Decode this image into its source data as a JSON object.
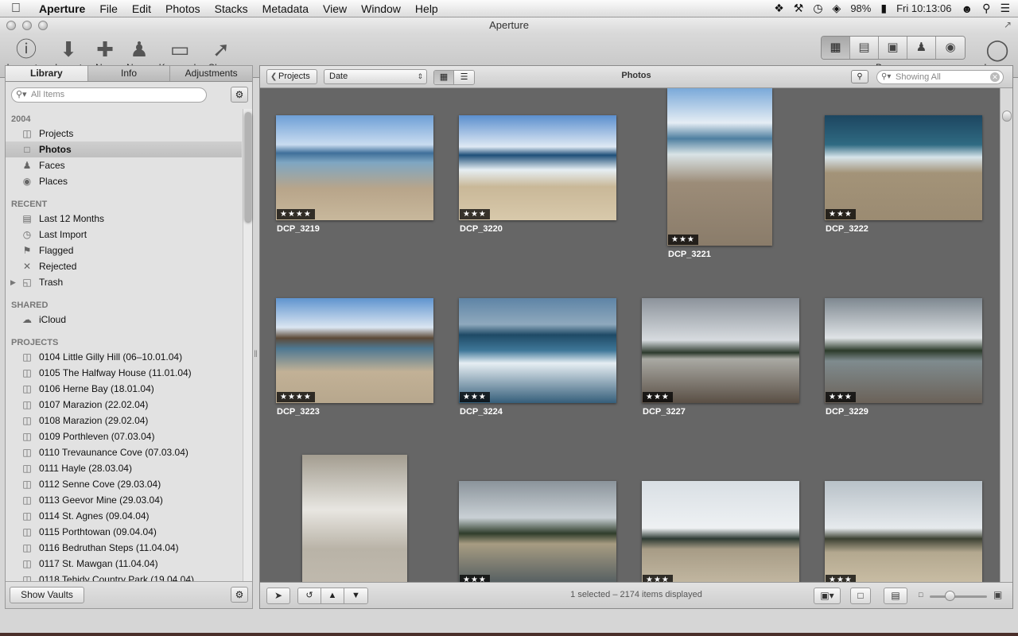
{
  "menubar": {
    "apple_icon": "",
    "items": [
      "Aperture",
      "File",
      "Edit",
      "Photos",
      "Stacks",
      "Metadata",
      "View",
      "Window",
      "Help"
    ],
    "battery": "98%",
    "clock": "Fri 10:13:06",
    "status_icons": [
      "dropbox-icon",
      "wrench-icon",
      "time-machine-icon",
      "wifi-icon",
      "battery-icon",
      "user-icon",
      "spotlight-icon",
      "list-icon"
    ]
  },
  "window": {
    "title": "Aperture"
  },
  "toolbar": {
    "inspector": "Inspector",
    "import": "Import",
    "new": "New",
    "name": "Name",
    "keywords": "Keywords",
    "share": "Share",
    "browser": "Browser",
    "loupe": "Loupe"
  },
  "library": {
    "tabs": [
      "Library",
      "Info",
      "Adjustments"
    ],
    "active_tab": "Library",
    "search_placeholder": "All Items",
    "sections": {
      "year": "2004",
      "recent": "RECENT",
      "shared": "SHARED",
      "projects": "PROJECTS"
    },
    "year_items": [
      "Projects",
      "Photos",
      "Faces",
      "Places"
    ],
    "selected_item": "Photos",
    "recent_items": [
      "Last 12 Months",
      "Last Import",
      "Flagged",
      "Rejected",
      "Trash"
    ],
    "shared_items": [
      "iCloud"
    ],
    "projects": [
      "0104 Little Gilly Hill (06–10.01.04)",
      "0105 The Halfway House (11.01.04)",
      "0106 Herne Bay (18.01.04)",
      "0107 Marazion (22.02.04)",
      "0108 Marazion (29.02.04)",
      "0109 Porthleven (07.03.04)",
      "0110 Trevaunance Cove (07.03.04)",
      "0111 Hayle (28.03.04)",
      "0112 Senne Cove (29.03.04)",
      "0113 Geevor Mine (29.03.04)",
      "0114 St. Agnes (09.04.04)",
      "0115 Porthtowan (09.04.04)",
      "0116 Bedruthan Steps (11.04.04)",
      "0117 St. Mawgan (11.04.04)",
      "0118 Tehidy Country Park (19.04.04)"
    ],
    "show_vaults": "Show Vaults"
  },
  "browser": {
    "projects_button": "Projects",
    "sort": "Date",
    "title": "Photos",
    "showing": "Showing All",
    "status": "1 selected – 2174 items displayed",
    "zoom_level": 0.35,
    "photos": [
      {
        "name": "DCP_3219",
        "stars": 4
      },
      {
        "name": "DCP_3220",
        "stars": 3
      },
      {
        "name": "DCP_3221",
        "stars": 3
      },
      {
        "name": "DCP_3222",
        "stars": 3
      },
      {
        "name": "DCP_3223",
        "stars": 4
      },
      {
        "name": "DCP_3224",
        "stars": 3
      },
      {
        "name": "DCP_3227",
        "stars": 3
      },
      {
        "name": "DCP_3229",
        "stars": 3
      },
      {
        "name": "",
        "stars": 0
      },
      {
        "name": "",
        "stars": 3
      },
      {
        "name": "",
        "stars": 3
      },
      {
        "name": "",
        "stars": 3
      }
    ]
  }
}
